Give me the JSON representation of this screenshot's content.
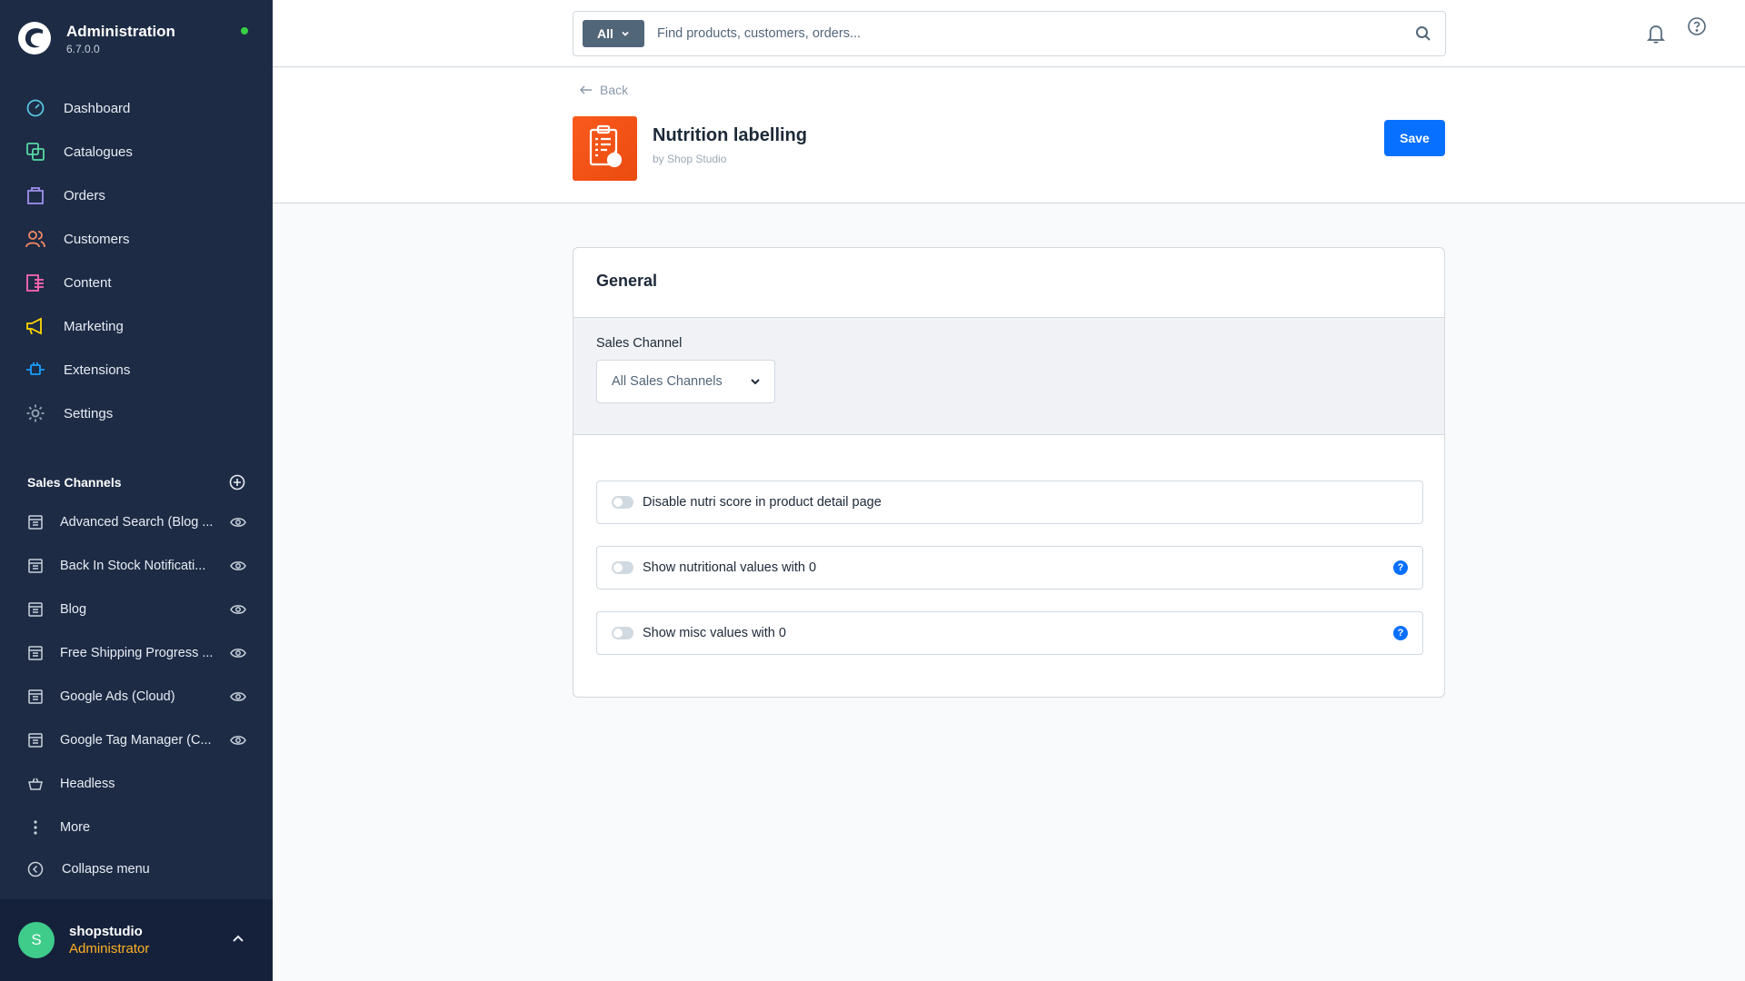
{
  "brand": {
    "title": "Administration",
    "version": "6.7.0.0",
    "status_color": "#37d046"
  },
  "nav": {
    "items": [
      {
        "label": "Dashboard",
        "icon": "dashboard-icon",
        "color": "#59c3de"
      },
      {
        "label": "Catalogues",
        "icon": "catalogue-icon",
        "color": "#57d9a3"
      },
      {
        "label": "Orders",
        "icon": "orders-icon",
        "color": "#a092f0"
      },
      {
        "label": "Customers",
        "icon": "customers-icon",
        "color": "#f88962"
      },
      {
        "label": "Content",
        "icon": "content-icon",
        "color": "#ff68b4"
      },
      {
        "label": "Marketing",
        "icon": "marketing-icon",
        "color": "#ffd700"
      },
      {
        "label": "Extensions",
        "icon": "extensions-icon",
        "color": "#189eff"
      },
      {
        "label": "Settings",
        "icon": "settings-icon",
        "color": "#9aa8b5"
      }
    ]
  },
  "sales_channels": {
    "title": "Sales Channels",
    "items": [
      {
        "label": "Advanced Search (Blog ..."
      },
      {
        "label": "Back In Stock Notificati..."
      },
      {
        "label": "Blog"
      },
      {
        "label": "Free Shipping Progress ..."
      },
      {
        "label": "Google Ads (Cloud)"
      },
      {
        "label": "Google Tag Manager (C..."
      },
      {
        "label": "Headless"
      }
    ],
    "more_label": "More",
    "collapse_label": "Collapse menu"
  },
  "user": {
    "initial": "S",
    "name": "shopstudio",
    "role": "Administrator"
  },
  "search": {
    "type_label": "All",
    "placeholder": "Find products, customers, orders..."
  },
  "header": {
    "back_label": "Back",
    "title": "Nutrition labelling",
    "author": "by Shop Studio",
    "save_label": "Save"
  },
  "card": {
    "title": "General",
    "channel_label": "Sales Channel",
    "channel_value": "All Sales Channels",
    "switches": [
      {
        "label": "Disable nutri score in product detail page",
        "has_hint": false
      },
      {
        "label": "Show nutritional values with 0",
        "has_hint": true
      },
      {
        "label": "Show misc values with 0",
        "has_hint": true
      }
    ],
    "hint_glyph": "?"
  },
  "colors": {
    "accent": "#0870ff",
    "sidebar": "#1d2b45",
    "role": "#ffb024",
    "avatar": "#3fcc8b"
  }
}
